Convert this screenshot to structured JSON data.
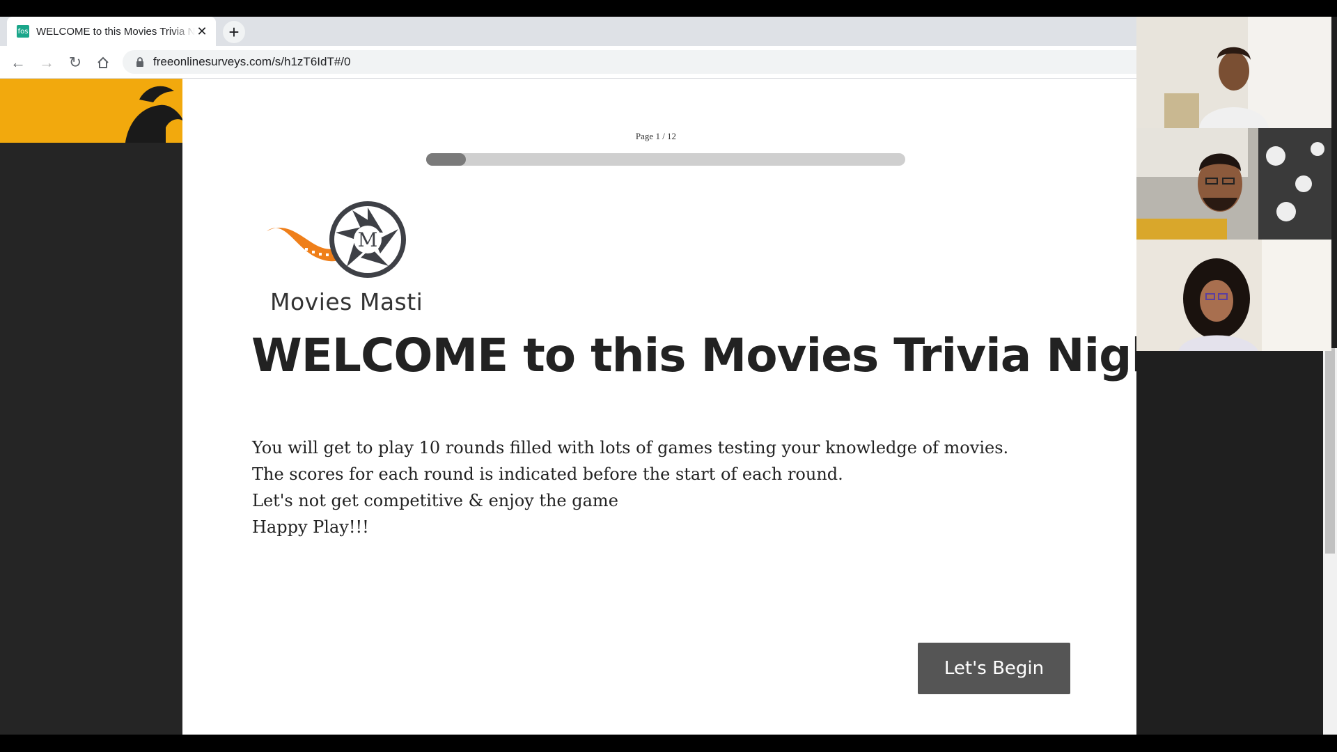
{
  "browser": {
    "tab": {
      "title": "WELCOME to this Movies Trivia Night",
      "favicon_text": "fos"
    },
    "new_tab_label": "+",
    "url": "freeonlinesurveys.com/s/h1zT6IdT#/0"
  },
  "survey": {
    "page_indicator": "Page 1 / 12",
    "progress_fraction": 0.083,
    "logo_text": "Movies Masti",
    "logo_letter": "M",
    "title": "WELCOME to this Movies Trivia Night",
    "description": [
      "You will get to play 10 rounds filled with lots of games testing your knowledge of movies.",
      "The scores for each round is indicated before the start of each round.",
      "Let's not get competitive & enjoy the game",
      "Happy Play!!!"
    ],
    "begin_button": "Let's Begin"
  },
  "colors": {
    "accent_orange": "#f2a90d",
    "button": "#555555",
    "progress_fill": "#7a7a7a"
  },
  "video_participants": 3
}
